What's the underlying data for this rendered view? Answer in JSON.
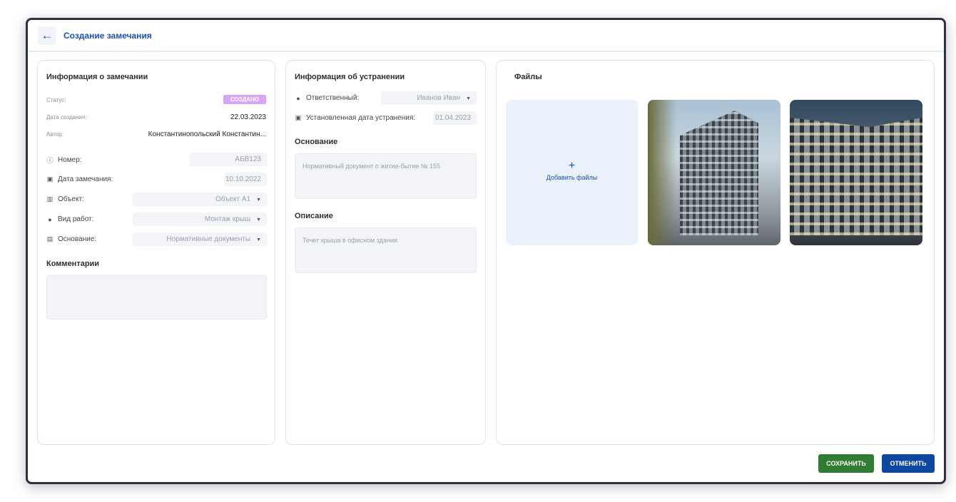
{
  "header": {
    "title": "Создание замечания",
    "back_icon": "arrow-left-icon"
  },
  "info": {
    "title": "Информация о замечании",
    "status_label": "Статус:",
    "status": "СОЗДАНО",
    "created_label": "Дата создания:",
    "created": "22.03.2023",
    "author_label": "Автор:",
    "author": "Константинопольский Константин...",
    "number_label": "Номер:",
    "number": "АБВ123",
    "date_label": "Дата замечания:",
    "date": "10.10.2022",
    "object_label": "Объект:",
    "object": "Объект А1",
    "work_label": "Вид работ:",
    "work": "Монтаж крыш",
    "basis_label": "Основание:",
    "basis": "Нормативные документы",
    "comments_title": "Комментарии"
  },
  "fix": {
    "title": "Информация об устранении",
    "resp_label": "Ответственный:",
    "resp": "Иванов Иван",
    "due_label": "Установленная дата устранения:",
    "due": "01.04.2023",
    "basis_title": "Основание",
    "basis_placeholder": "Нормативный документ о житие-бытие № 155",
    "desc_title": "Описание",
    "desc_placeholder": "Течет крыша в офисном здании"
  },
  "files": {
    "title": "Файлы",
    "add_label": "Добавить файлы"
  },
  "actions": {
    "save": "СОХРАНИТЬ",
    "cancel": "ОТМЕНИТЬ"
  },
  "colors": {
    "accent": "#1a4fba",
    "save": "#2e7d32",
    "cancel": "#0d47a1",
    "badge": "#d9a6f5"
  }
}
